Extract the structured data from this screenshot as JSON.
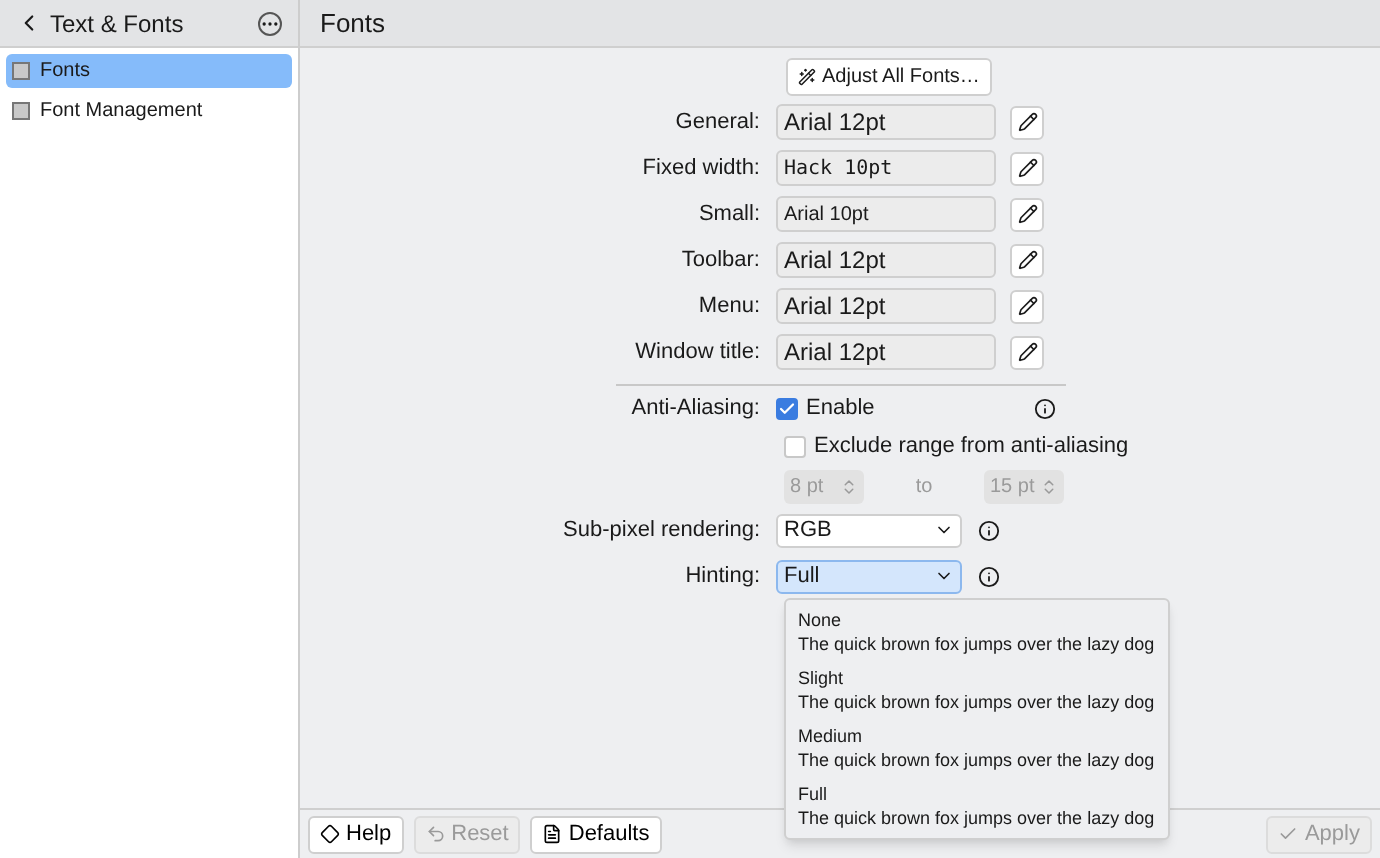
{
  "sidebar": {
    "title": "Text & Fonts",
    "items": [
      {
        "label": "Fonts",
        "selected": true
      },
      {
        "label": "Font Management",
        "selected": false
      }
    ]
  },
  "page_title": "Fonts",
  "adjust_button": "Adjust All Fonts…",
  "fonts": [
    {
      "label": "General:",
      "value": "Arial 12pt",
      "kind": "normal"
    },
    {
      "label": "Fixed width:",
      "value": "Hack 10pt",
      "kind": "mono"
    },
    {
      "label": "Small:",
      "value": "Arial 10pt",
      "kind": "small"
    },
    {
      "label": "Toolbar:",
      "value": "Arial 12pt",
      "kind": "normal"
    },
    {
      "label": "Menu:",
      "value": "Arial 12pt",
      "kind": "normal"
    },
    {
      "label": "Window title:",
      "value": "Arial 12pt",
      "kind": "normal"
    }
  ],
  "anti_aliasing": {
    "label": "Anti-Aliasing:",
    "enable": {
      "label": "Enable",
      "checked": true
    },
    "exclude": {
      "label": "Exclude range from anti-aliasing",
      "checked": false
    },
    "from": "8 pt",
    "to_label": "to",
    "to": "15 pt"
  },
  "subpixel": {
    "label": "Sub-pixel rendering:",
    "value": "RGB"
  },
  "hinting": {
    "label": "Hinting:",
    "value": "Full",
    "options": [
      {
        "name": "None",
        "sample": "The quick brown fox jumps over the lazy dog"
      },
      {
        "name": "Slight",
        "sample": "The quick brown fox jumps over the lazy dog"
      },
      {
        "name": "Medium",
        "sample": "The quick brown fox jumps over the lazy dog"
      },
      {
        "name": "Full",
        "sample": "The quick brown fox jumps over the lazy dog"
      }
    ]
  },
  "footer": [
    {
      "label": "Help",
      "kind": "help",
      "disabled": false
    },
    {
      "label": "Reset",
      "kind": "reset",
      "disabled": true
    },
    {
      "label": "Defaults",
      "kind": "defaults",
      "disabled": false
    },
    {
      "label": "Apply",
      "kind": "apply",
      "disabled": true
    }
  ]
}
